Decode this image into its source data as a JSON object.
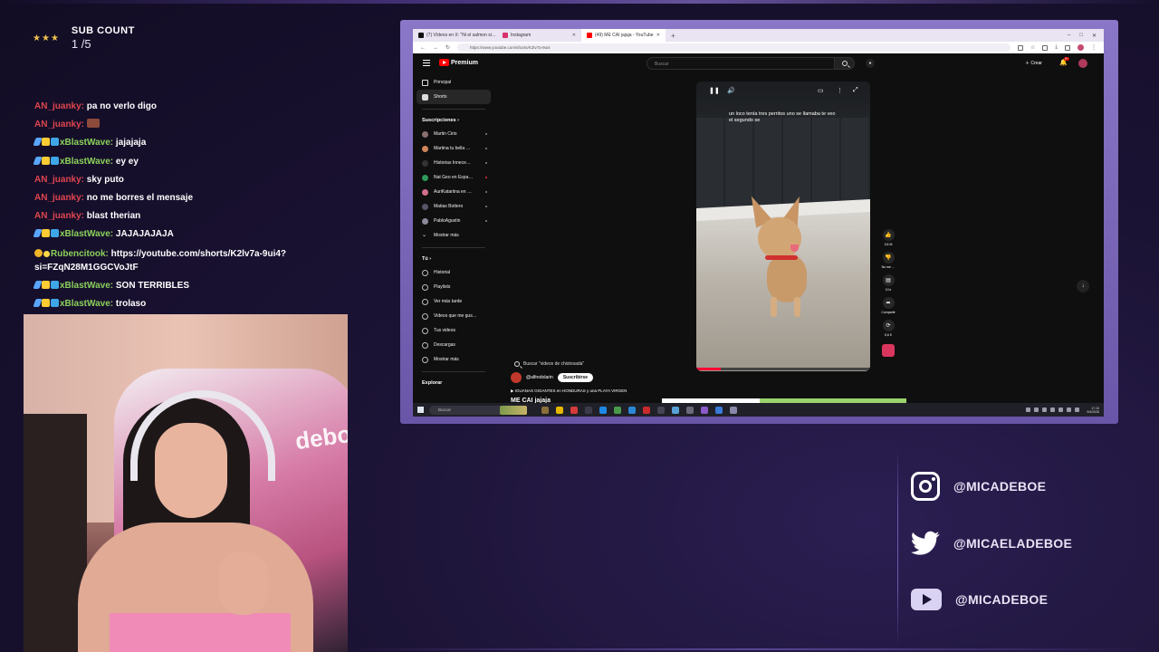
{
  "overlay": {
    "sub_count_title": "SUB COUNT",
    "sub_count_value": "1 /5"
  },
  "chat": [
    {
      "user": "AN_juanky:",
      "text": "pa no verlo digo",
      "color": "#e0454f",
      "badges": []
    },
    {
      "user": "AN_juanky:",
      "text": "",
      "color": "#e0454f",
      "badges": [],
      "emote": true
    },
    {
      "user": "xBlastWave:",
      "text": "jajajaja",
      "color": "#8bd15b",
      "badges": [
        "sword",
        "crown",
        "grid"
      ]
    },
    {
      "user": "xBlastWave:",
      "text": "ey ey",
      "color": "#8bd15b",
      "badges": [
        "sword",
        "crown",
        "grid"
      ]
    },
    {
      "user": "AN_juanky:",
      "text": "sky puto",
      "color": "#e0454f",
      "badges": []
    },
    {
      "user": "AN_juanky:",
      "text": "no me borres el mensaje",
      "color": "#e0454f",
      "badges": []
    },
    {
      "user": "AN_juanky:",
      "text": "blast therian",
      "color": "#e0454f",
      "badges": []
    },
    {
      "user": "xBlastWave:",
      "text": "JAJAJAJAJA",
      "color": "#8bd15b",
      "badges": [
        "sword",
        "crown",
        "grid"
      ]
    },
    {
      "user": "Rubencitook:",
      "text": "https://youtube.com/shorts/K2lv7a-9ui4?si=FZqN28M1GGCVoJtF",
      "color": "#8bd15b",
      "badges": [
        "timer",
        "sun"
      ],
      "wrap": true
    },
    {
      "user": "xBlastWave:",
      "text": "SON TERRIBLES",
      "color": "#8bd15b",
      "badges": [
        "sword",
        "crown",
        "grid"
      ]
    },
    {
      "user": "xBlastWave:",
      "text": "trolaso",
      "color": "#8bd15b",
      "badges": [
        "sword",
        "crown",
        "grid"
      ]
    }
  ],
  "webcam": {
    "chair_text": "deboe"
  },
  "browser": {
    "tabs": [
      {
        "label": "(7) Vídeos en X: \"Ni el salmon si…",
        "favicon": "#111111",
        "active": false
      },
      {
        "label": "Instagram",
        "favicon": "#d6336c",
        "active": false
      },
      {
        "label": "(49) ME CAI jajaja - YouTube",
        "favicon": "#ff0000",
        "active": true
      }
    ],
    "url": "https://www.youtube.com/shorts/K2lv7a-9ui4",
    "youtube": {
      "brand": "Premium",
      "search_placeholder": "Buscar",
      "create_label": "Crear",
      "notif_badge": "9+",
      "sidebar_main": [
        {
          "label": "Principal",
          "icon": "home-icon",
          "active": false
        },
        {
          "label": "Shorts",
          "icon": "shorts-icon",
          "active": true
        }
      ],
      "subscriptions_title": "Suscripciones  ›",
      "subscriptions": [
        {
          "label": "Martin Cirio",
          "color": "#8a6f6f",
          "live": false
        },
        {
          "label": "Martina tu bella …",
          "color": "#d0845a",
          "live": false
        },
        {
          "label": "Historias Innece…",
          "color": "#333333",
          "live": false
        },
        {
          "label": "Nat Geo en Espa…",
          "color": "#2e9a5a",
          "live": true
        },
        {
          "label": "AuriKatariina en …",
          "color": "#d0708a",
          "live": false
        },
        {
          "label": "Matias Bottero",
          "color": "#555566",
          "live": false
        },
        {
          "label": "PabloAgustin",
          "color": "#8a8a9a",
          "live": false
        }
      ],
      "show_more": "Mostrar más",
      "you_title": "Tú  ›",
      "you_items": [
        {
          "label": "Historial",
          "icon": "history-icon"
        },
        {
          "label": "Playlists",
          "icon": "playlists-icon"
        },
        {
          "label": "Ver más tarde",
          "icon": "watch-later-icon"
        },
        {
          "label": "Videos que me gus…",
          "icon": "liked-icon"
        },
        {
          "label": "Tus videos",
          "icon": "your-videos-icon"
        },
        {
          "label": "Descargas",
          "icon": "downloads-icon"
        },
        {
          "label": "Mostrar más",
          "icon": "chevron-down-icon"
        }
      ],
      "explore_title": "Explorar",
      "short": {
        "search_suggestion": "Buscar \"videos de chistosada\"",
        "channel": "@alfredolarin",
        "subscribe": "Suscribirse",
        "linked_video": "IGUANAS GIGANTES en HONDURAS y una PLAYA VIRGEN",
        "title": "ME CAI jajaja",
        "caption": "un loco tenía tres perritos uno se llamaba te veo el segundo se",
        "progress": 0.14,
        "likes": "3,6 M",
        "dislike_label": "No me …",
        "comments": "10 k",
        "share_label": "Compartir",
        "remix": "5,6 K"
      }
    },
    "taskbar": {
      "search_placeholder": "Buscar",
      "time": "17:10",
      "date": "9/4/2026",
      "apps": [
        "#8a6f3a",
        "#e6b800",
        "#d43b3b",
        "#3a3a4a",
        "#1e88e5",
        "#4a9a4a",
        "#2b88d8",
        "#c92b2b",
        "#444455",
        "#5aa0d8",
        "#6a6a7a",
        "#8a5ac8",
        "#3a7ad8",
        "#8888aa"
      ]
    }
  },
  "socials": [
    {
      "handle": "@MICADEBOE",
      "icon": "instagram-icon"
    },
    {
      "handle": "@MICAELADEBOE",
      "icon": "twitter-icon"
    },
    {
      "handle": "@MICADEBOE",
      "icon": "youtube-icon"
    }
  ]
}
